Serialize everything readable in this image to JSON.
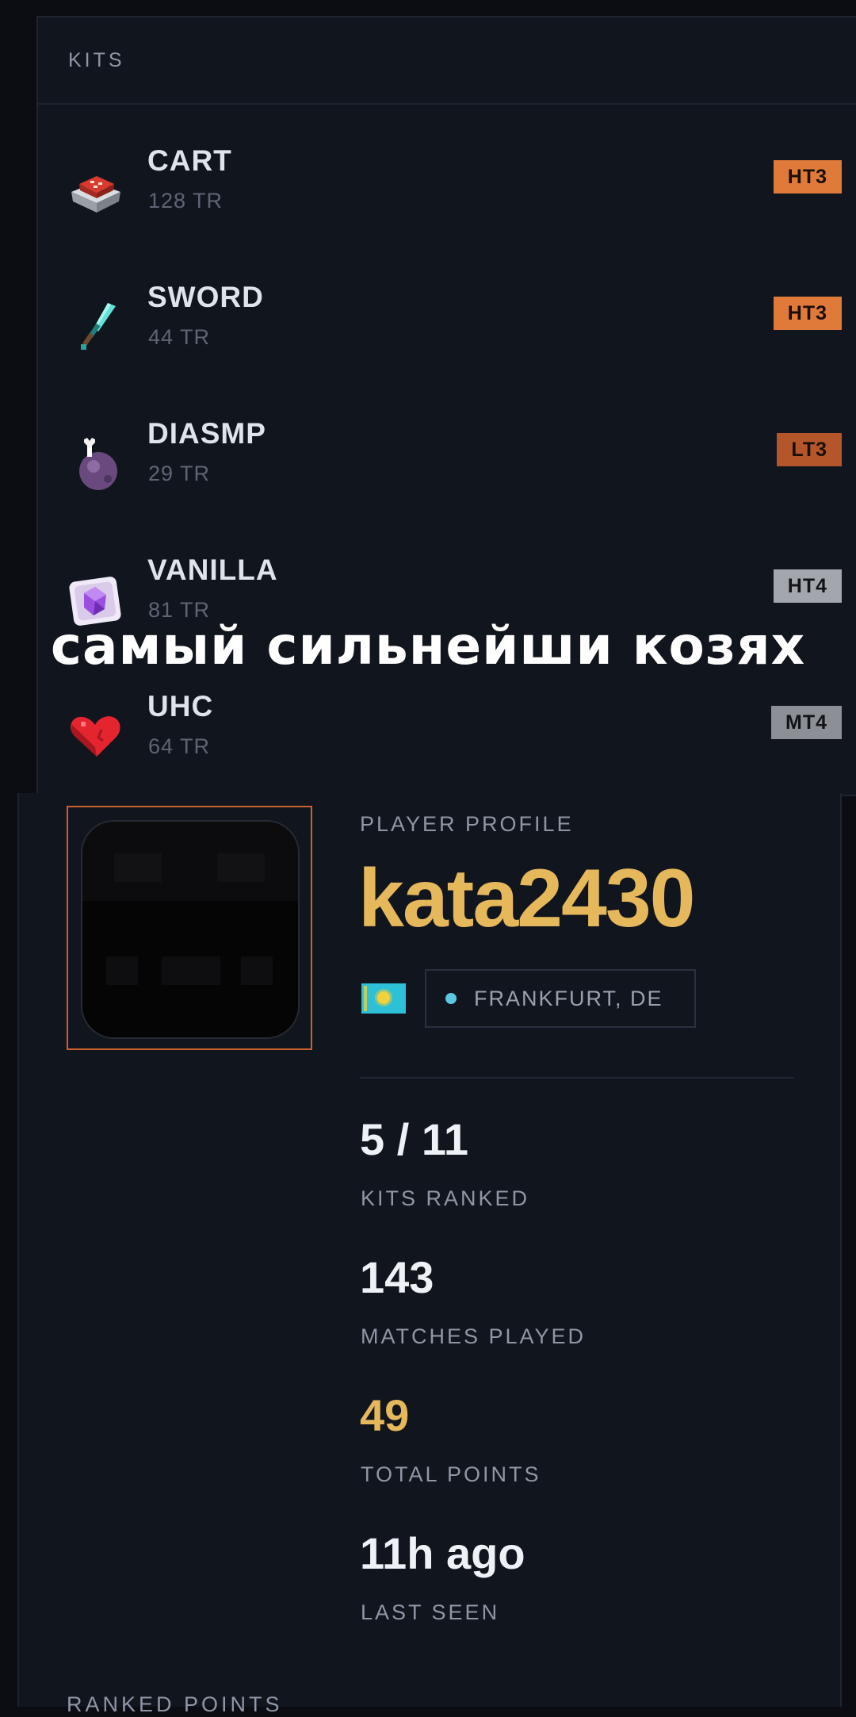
{
  "kits": {
    "header": "KITS",
    "items": [
      {
        "name": "CART",
        "rating": "128 TR",
        "tier": "HT3",
        "tier_bg": "#e07a3a",
        "tier_fg": "#1a0f08",
        "icon": "minecart-tnt-icon"
      },
      {
        "name": "SWORD",
        "rating": "44 TR",
        "tier": "HT3",
        "tier_bg": "#e07a3a",
        "tier_fg": "#1a0f08",
        "icon": "diamond-sword-icon"
      },
      {
        "name": "DIASMP",
        "rating": "29 TR",
        "tier": "LT3",
        "tier_bg": "#b5562a",
        "tier_fg": "#1a0f08",
        "icon": "potion-icon"
      },
      {
        "name": "VANILLA",
        "rating": "81 TR",
        "tier": "HT4",
        "tier_bg": "#a3a7ad",
        "tier_fg": "#111317",
        "icon": "end-crystal-icon"
      },
      {
        "name": "UHC",
        "rating": "64 TR",
        "tier": "MT4",
        "tier_bg": "#8c9096",
        "tier_fg": "#111317",
        "icon": "heart-icon"
      }
    ]
  },
  "overlay_caption": "самый сильнейши козях",
  "profile": {
    "label": "PLAYER PROFILE",
    "username": "kata2430",
    "flag": "kazakhstan-flag-icon",
    "location": "FRANKFURT, DE",
    "stats": [
      {
        "value": "5 / 11",
        "label": "KITS RANKED",
        "accent": false
      },
      {
        "value": "143",
        "label": "MATCHES PLAYED",
        "accent": false
      },
      {
        "value": "49",
        "label": "TOTAL POINTS",
        "accent": true
      },
      {
        "value": "11h ago",
        "label": "LAST SEEN",
        "accent": false
      }
    ],
    "ranked_points_label": "RANKED POINTS"
  },
  "colors": {
    "background": "#0b0d12",
    "panel": "#11151d",
    "accent_gold": "#e6b85c",
    "avatar_border": "#c9622d"
  }
}
